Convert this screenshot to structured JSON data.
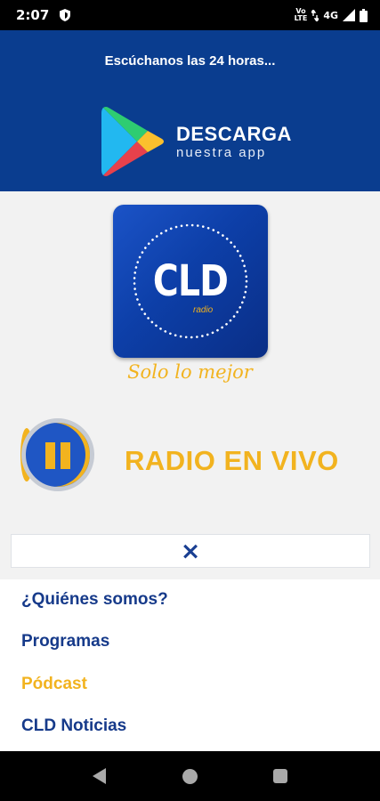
{
  "status_bar": {
    "time": "2:07",
    "volte_line1": "Vo",
    "volte_line2": "LTE",
    "network": "4G",
    "icons": [
      "shield-icon",
      "data-arrows-icon",
      "signal-icon",
      "battery-icon"
    ]
  },
  "header": {
    "tagline": "Escúchanos las 24 horas...",
    "download_title": "DESCARGA",
    "download_subtitle": "nuestra app",
    "background_color": "#0a3d8f"
  },
  "logo": {
    "text": "CLD",
    "subtext": "radio"
  },
  "slogan": "Solo lo mejor",
  "player": {
    "state_icon": "pause-icon",
    "live_label": "RADIO EN VIVO",
    "accent_color": "#f2b31f"
  },
  "close_bar": {
    "icon": "×"
  },
  "menu": {
    "items": [
      {
        "label": "¿Quiénes somos?",
        "active": false
      },
      {
        "label": "Programas",
        "active": false
      },
      {
        "label": "Pódcast",
        "active": true
      },
      {
        "label": "CLD Noticias",
        "active": false
      }
    ]
  },
  "nav_bar": {
    "icons": [
      "back-icon",
      "home-icon",
      "recents-icon"
    ]
  }
}
